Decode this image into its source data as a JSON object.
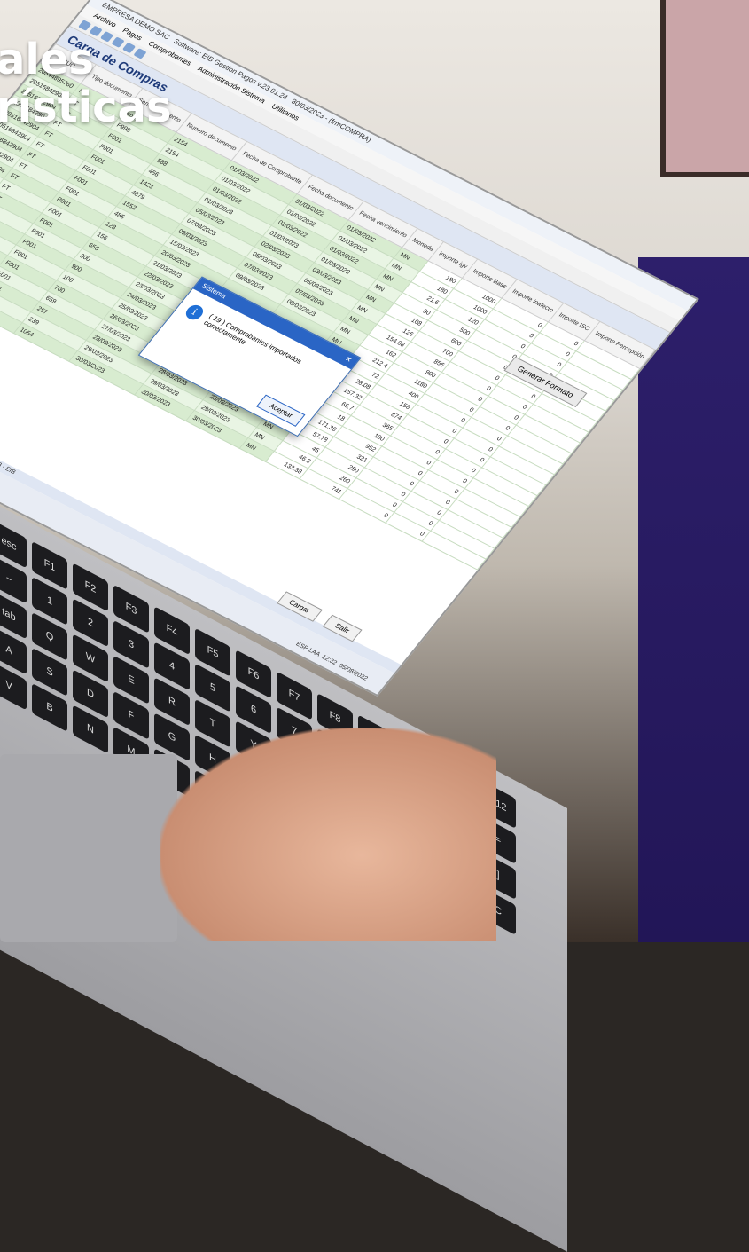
{
  "headline": {
    "line1": "ales",
    "line2": "rísticas"
  },
  "window": {
    "title": "EMPRESA DEMO SAC",
    "app": "Software: EIB Gestion Pagos v.23.01.24",
    "date": "30/03/2023 - (frmCOMPRA)",
    "menu": [
      "Archivo",
      "Pagos",
      "Comprobantes",
      "Administración Sistema",
      "Utilitarios"
    ],
    "form_title": "Carga de Compras",
    "generate_button": "Generar Formato",
    "columns": [
      "RUC",
      "Tipo documento",
      "Serie documento",
      "Numero documento",
      "Fecha de Comprobante",
      "Fecha documento",
      "Fecha vencimiento",
      "Moneda",
      "Importe igv",
      "Importe Base",
      "Importe inafecto",
      "Importe ISC",
      "Importe Percepción"
    ],
    "rows": [
      [
        "20544895760",
        "FT",
        "F999",
        "2154",
        "01/03/2022",
        "01/03/2022",
        "01/03/2022",
        "MN",
        "180",
        "1000",
        "0",
        "0",
        ""
      ],
      [
        "20516842904",
        "FT",
        "F999",
        "2154",
        "01/03/2022",
        "01/03/2022",
        "01/03/2022",
        "MN",
        "180",
        "1000",
        "0",
        "0",
        ""
      ],
      [
        "20516842904",
        "FT",
        "F001",
        "588",
        "01/03/2022",
        "01/03/2022",
        "01/03/2022",
        "MN",
        "21.6",
        "120",
        "0",
        "0",
        ""
      ],
      [
        "20516842904",
        "FT",
        "F001",
        "456",
        "01/03/2023",
        "01/03/2023",
        "01/03/2023",
        "MN",
        "90",
        "500",
        "0",
        "0",
        ""
      ],
      [
        "20516842904",
        "FT",
        "F001",
        "1423",
        "05/03/2023",
        "02/03/2023",
        "03/03/2023",
        "MN",
        "108",
        "600",
        "0",
        "0",
        ""
      ],
      [
        "20516842904",
        "FT",
        "F001",
        "4879",
        "07/03/2023",
        "05/03/2023",
        "05/03/2023",
        "MN",
        "126",
        "700",
        "0",
        "0",
        ""
      ],
      [
        "20516842904",
        "FT",
        "F001",
        "1552",
        "09/03/2023",
        "07/03/2023",
        "07/03/2023",
        "MN",
        "154.08",
        "856",
        "0",
        "0",
        ""
      ],
      [
        "20516842904",
        "FT",
        "F001",
        "485",
        "15/03/2023",
        "09/03/2023",
        "09/03/2023",
        "MN",
        "162",
        "900",
        "0",
        "0",
        ""
      ],
      [
        "20516842904",
        "FT",
        "P001",
        "123",
        "20/03/2023",
        "",
        "",
        "MN",
        "212.4",
        "1180",
        "0",
        "0",
        ""
      ],
      [
        "20516842904",
        "FT",
        "F001",
        "156",
        "21/03/2023",
        "",
        "",
        "",
        "72",
        "400",
        "0",
        "0",
        ""
      ],
      [
        "20516842904",
        "FT",
        "F001",
        "656",
        "22/03/2023",
        "",
        "",
        "",
        "28.08",
        "156",
        "0",
        "0",
        ""
      ],
      [
        "20516842904",
        "FT",
        "F001",
        "800",
        "23/03/2023",
        "",
        "",
        "",
        "157.32",
        "874",
        "0",
        "0",
        ""
      ],
      [
        "20516842904",
        "FT",
        "F001",
        "900",
        "24/03/2023",
        "",
        "",
        "",
        "65.7",
        "365",
        "0",
        "0",
        ""
      ],
      [
        "20516842904",
        "FT",
        "F001",
        "100",
        "25/03/2023",
        "",
        "",
        "",
        "18",
        "100",
        "0",
        "0",
        ""
      ],
      [
        "20516842904",
        "FT",
        "F001",
        "700",
        "26/03/2023",
        "26/03/2023",
        "26/03/2023",
        "MN",
        "171.36",
        "952",
        "0",
        "0",
        ""
      ],
      [
        "20516842904",
        "FT",
        "F001",
        "659",
        "27/03/2023",
        "27/03/2023",
        "27/03/2023",
        "MN",
        "57.78",
        "321",
        "0",
        "0",
        ""
      ],
      [
        "20516842904",
        "FT",
        "F001",
        "257",
        "28/03/2023",
        "28/03/2023",
        "28/03/2023",
        "MN",
        "45",
        "250",
        "0",
        "0",
        ""
      ],
      [
        "20516842904",
        "FT",
        "F001",
        "239",
        "29/03/2023",
        "29/03/2023",
        "29/03/2023",
        "MN",
        "46.8",
        "260",
        "0",
        "0",
        ""
      ],
      [
        "20516842904",
        "FT",
        "P001",
        "1054",
        "30/03/2023",
        "30/03/2023",
        "30/03/2023",
        "MN",
        "133.38",
        "741",
        "0",
        "0",
        ""
      ]
    ],
    "status": "Estado: Compañía: EMPRESA DEMO SAC / Sucursal: PRINCIPAL / Usuario: EIB - EIB",
    "load_button": "Cargar",
    "exit_button": "Salir"
  },
  "dialog": {
    "title": "Sistema",
    "message": "( 19 ) Comprobantes importados correctamente",
    "ok": "Aceptar"
  },
  "tray": {
    "lang": "ESP LAA",
    "time": "12:32",
    "date": "05/08/2022"
  },
  "keyboard": {
    "keys": [
      "esc",
      "F1",
      "F2",
      "F3",
      "F4",
      "F5",
      "F6",
      "F7",
      "F8",
      "F9",
      "F10",
      "F11",
      "F12",
      "~",
      "1",
      "2",
      "3",
      "4",
      "5",
      "6",
      "7",
      "8",
      "9",
      "0",
      "-",
      "=",
      "tab",
      "Q",
      "W",
      "E",
      "R",
      "T",
      "Y",
      "U",
      "I",
      "O",
      "P",
      "[",
      "]",
      "A",
      "S",
      "D",
      "F",
      "G",
      "H",
      "J",
      "K",
      "L",
      ";",
      "Z",
      "X",
      "C",
      "V",
      "B",
      "N",
      "M",
      ",",
      "."
    ]
  }
}
